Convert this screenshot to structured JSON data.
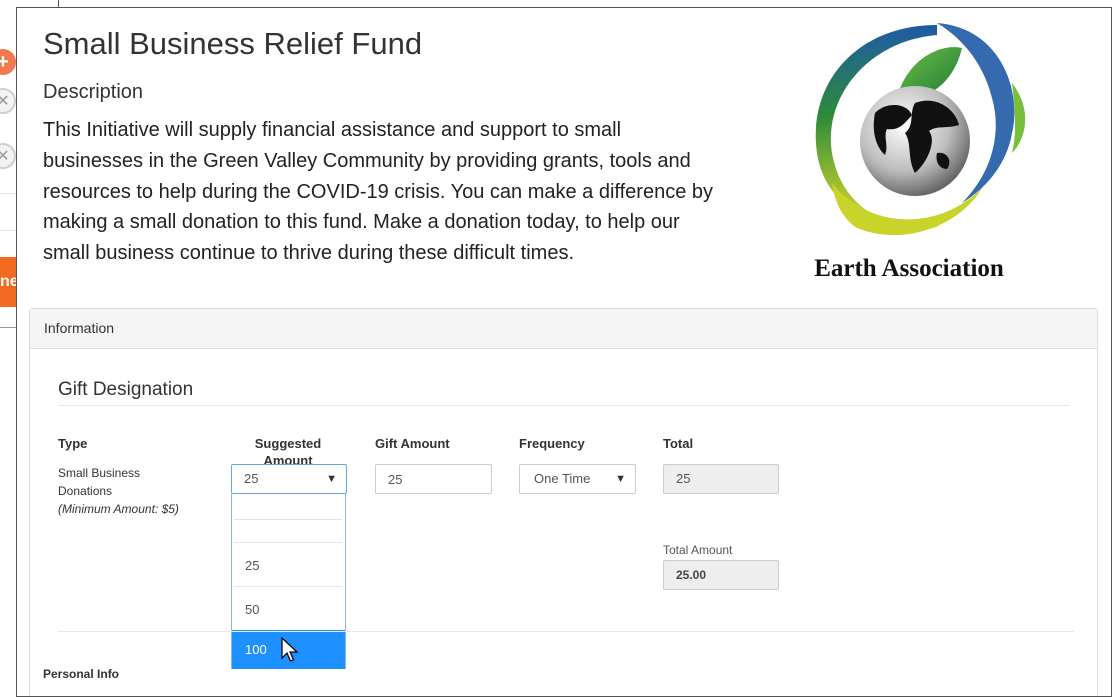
{
  "background": {
    "side_button_partial_text": "ne"
  },
  "page": {
    "title": "Small Business Relief Fund",
    "description_label": "Description",
    "description": "This Initiative will supply financial assistance and support to small businesses in the Green Valley Community by providing grants, tools and resources to help during the COVID-19 crisis. You can make a difference by making a small donation to this fund. Make a donation today, to help our small business continue to thrive during these difficult times.",
    "logo_text": "Earth Association"
  },
  "panel": {
    "header": "Information",
    "section_title": "Gift Designation",
    "columns": {
      "type": "Type",
      "suggested_line1": "Suggested",
      "suggested_line2": "Amount",
      "gift_amount": "Gift Amount",
      "frequency": "Frequency",
      "total": "Total"
    },
    "row": {
      "type_line1": "Small Business",
      "type_line2": "Donations",
      "min_amount": "(Minimum Amount: $5)",
      "suggested_value": "25",
      "gift_amount_value": "25",
      "frequency_value": "One Time",
      "total_value": "25"
    },
    "dropdown_options": [
      "",
      "25",
      "50",
      "100"
    ],
    "dropdown_selected_index": 3,
    "total_amount_label": "Total Amount",
    "total_amount_value": "25.00",
    "personal_info_label": "Personal Info"
  },
  "colors": {
    "accent_blue": "#1e90ff",
    "orange": "#f26a22",
    "logo_green": "#2e8b3a",
    "logo_blue": "#1f5aa6",
    "logo_yellow": "#d8d62a"
  }
}
